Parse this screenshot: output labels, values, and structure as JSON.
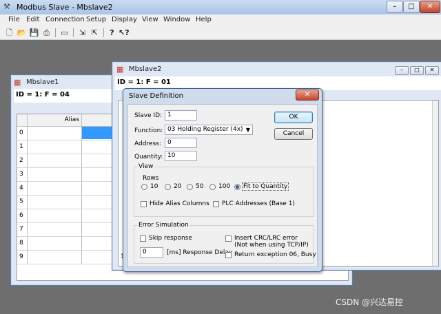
{
  "app": {
    "title": "Modbus Slave - Mbslave2"
  },
  "menu": [
    "File",
    "Edit",
    "Connection",
    "Setup",
    "Display",
    "View",
    "Window",
    "Help"
  ],
  "toolbar_icons": [
    "new-file-icon",
    "open-folder-icon",
    "save-icon",
    "print-icon",
    "window-icon",
    "transmit-icon",
    "receive-icon",
    "help-icon",
    "context-help-icon"
  ],
  "window_controls": {
    "minimize": "–",
    "maximize": "□",
    "close": "✕"
  },
  "mbslave1": {
    "title": "Mbslave1",
    "id_line": "ID = 1: F = 04",
    "alias_header": "Alias",
    "rows": [
      "0",
      "1",
      "2",
      "3",
      "4",
      "5",
      "6",
      "7",
      "8",
      "9"
    ]
  },
  "mbslave2": {
    "title": "Mbslave2",
    "id_line": "ID = 1: F = 01",
    "row_partial": "1"
  },
  "dialog": {
    "title": "Slave Definition",
    "slave_id_label": "Slave ID:",
    "slave_id": "1",
    "function_label": "Function:",
    "function_value": "03 Holding Register (4x)",
    "address_label": "Address:",
    "address": "0",
    "quantity_label": "Quantity:",
    "quantity": "10",
    "ok": "OK",
    "cancel": "Cancel",
    "view_group": "View",
    "rows_label": "Rows",
    "row_options": [
      "10",
      "20",
      "50",
      "100",
      "Fit to Quantity"
    ],
    "selected_row_option": "Fit to Quantity",
    "hide_alias": "Hide Alias Columns",
    "plc_addresses": "PLC Addresses (Base 1)",
    "error_group": "Error Simulation",
    "skip_response": "Skip response",
    "insert_crc": "Insert CRC/LRC error",
    "insert_crc_note": "(Not when using TCP/IP)",
    "delay_value": "0",
    "delay_label": "[ms] Response Delay",
    "return_exception": "Return exception 06, Busy"
  },
  "watermark": "CSDN @兴达易控"
}
